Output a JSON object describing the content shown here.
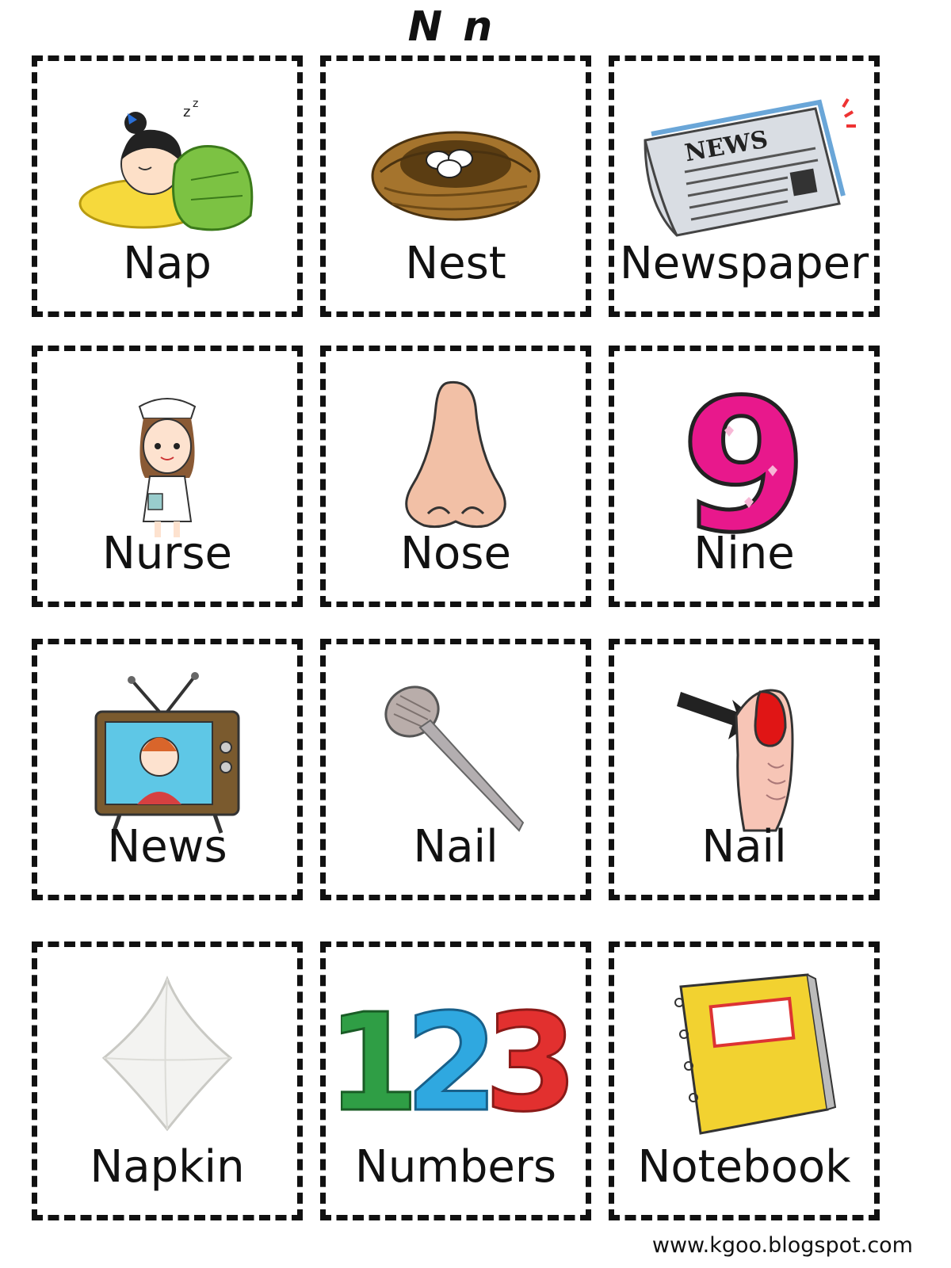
{
  "page": {
    "title": "N n",
    "footer": "www.kgoo.blogspot.com"
  },
  "cards": [
    {
      "word": "Nap",
      "icon": "sleeping-girl-icon"
    },
    {
      "word": "Nest",
      "icon": "nest-icon"
    },
    {
      "word": "Newspaper",
      "icon": "newspaper-icon"
    },
    {
      "word": "Nurse",
      "icon": "nurse-icon"
    },
    {
      "word": "Nose",
      "icon": "nose-icon"
    },
    {
      "word": "Nine",
      "icon": "nine-icon"
    },
    {
      "word": "News",
      "icon": "tv-news-icon"
    },
    {
      "word": "Nail",
      "icon": "metal-nail-icon"
    },
    {
      "word": "Nail",
      "icon": "fingernail-icon"
    },
    {
      "word": "Napkin",
      "icon": "napkin-icon"
    },
    {
      "word": "Numbers",
      "icon": "numbers-123-icon"
    },
    {
      "word": "Notebook",
      "icon": "notebook-icon"
    }
  ],
  "icon_text": {
    "newspaper_masthead": "NEWS"
  },
  "colors": {
    "border": "#111111",
    "nine_pink": "#e8188c",
    "notebook_yellow": "#f2d230"
  }
}
